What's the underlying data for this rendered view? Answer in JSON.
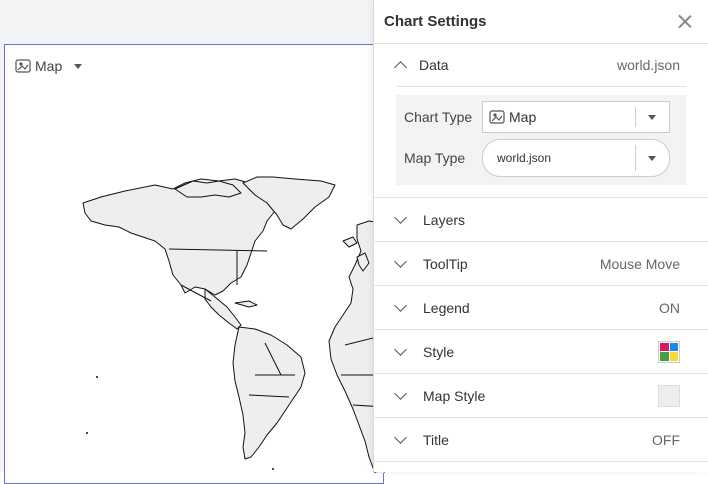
{
  "chart": {
    "type_label": "Map"
  },
  "panel": {
    "title": "Chart Settings",
    "data": {
      "label": "Data",
      "value": "world.json",
      "chart_type_label": "Chart Type",
      "chart_type_value": "Map",
      "map_type_label": "Map Type",
      "map_type_value": "world.json"
    },
    "sections": [
      {
        "label": "Layers",
        "value": ""
      },
      {
        "label": "ToolTip",
        "value": "Mouse Move"
      },
      {
        "label": "Legend",
        "value": "ON"
      },
      {
        "label": "Style",
        "value": ""
      },
      {
        "label": "Map Style",
        "value": ""
      },
      {
        "label": "Title",
        "value": "OFF"
      }
    ],
    "style_swatch_colors": [
      "#d81b60",
      "#1e88e5",
      "#43a047",
      "#fdd835"
    ],
    "map_style_color": "#eeeeee"
  },
  "colors": {
    "map_fill": "#eeeeee",
    "map_stroke": "#111111",
    "card_border": "#6b72c8"
  },
  "icons": {
    "chart_type": "map-icon",
    "close": "close-icon",
    "expand": "chevron-down-icon",
    "collapse": "chevron-up-icon"
  }
}
